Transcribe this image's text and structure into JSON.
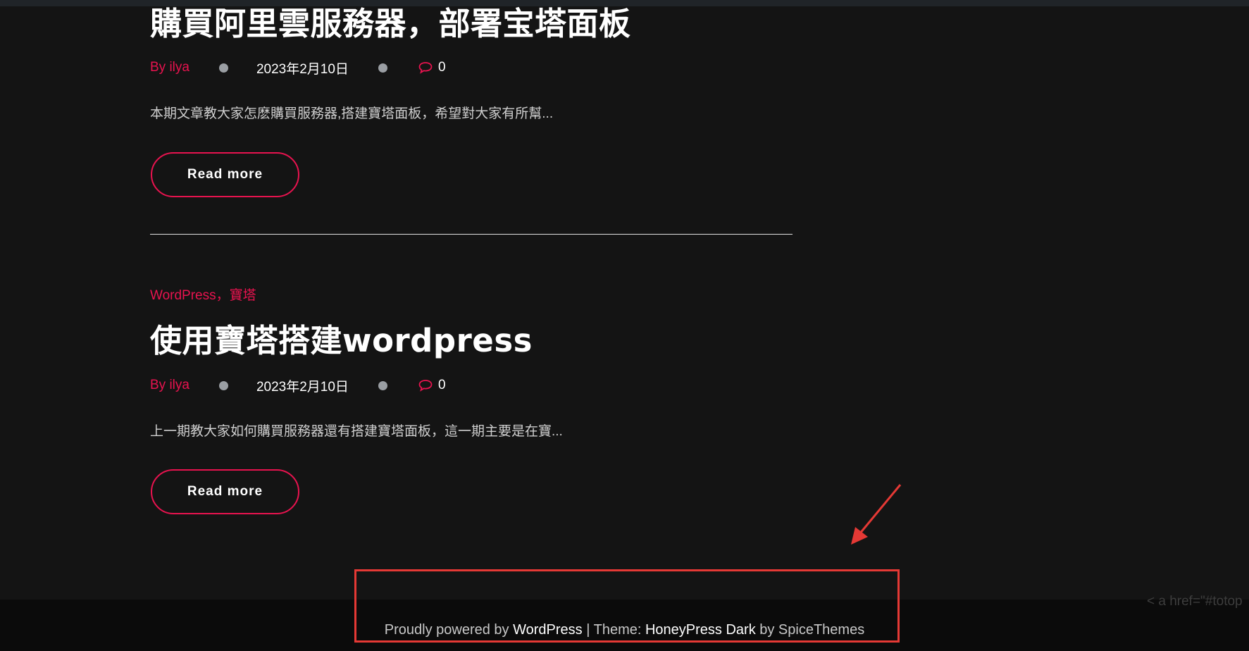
{
  "posts": [
    {
      "title": "購買阿里雲服務器，部署宝塔面板",
      "author": "By ilya",
      "date": "2023年2月10日",
      "comments": "0",
      "excerpt": "本期文章教大家怎麽購買服務器,搭建寶塔面板，希望對大家有所幫...",
      "read_more": "Read more"
    },
    {
      "categories": "WordPress，寶塔",
      "title": "使用寶塔搭建wordpress",
      "author": "By ilya",
      "date": "2023年2月10日",
      "comments": "0",
      "excerpt": "上一期教大家如何購買服務器還有搭建寶塔面板，這一期主要是在寶...",
      "read_more": "Read more"
    }
  ],
  "footer": {
    "prefix": "Proudly powered by ",
    "wordpress": "WordPress",
    "separator": " | Theme: ",
    "theme": "HoneyPress Dark",
    "suffix": " by SpiceThemes"
  },
  "code_snippet": "< a href=\"#totop",
  "colors": {
    "accent": "#e8134f",
    "background": "#141414",
    "footer_bg": "#0b0b0b",
    "annotation": "#e53935"
  },
  "icons": {
    "comment": "comment-bubble-icon",
    "annotation_arrow": "arrow-icon"
  }
}
